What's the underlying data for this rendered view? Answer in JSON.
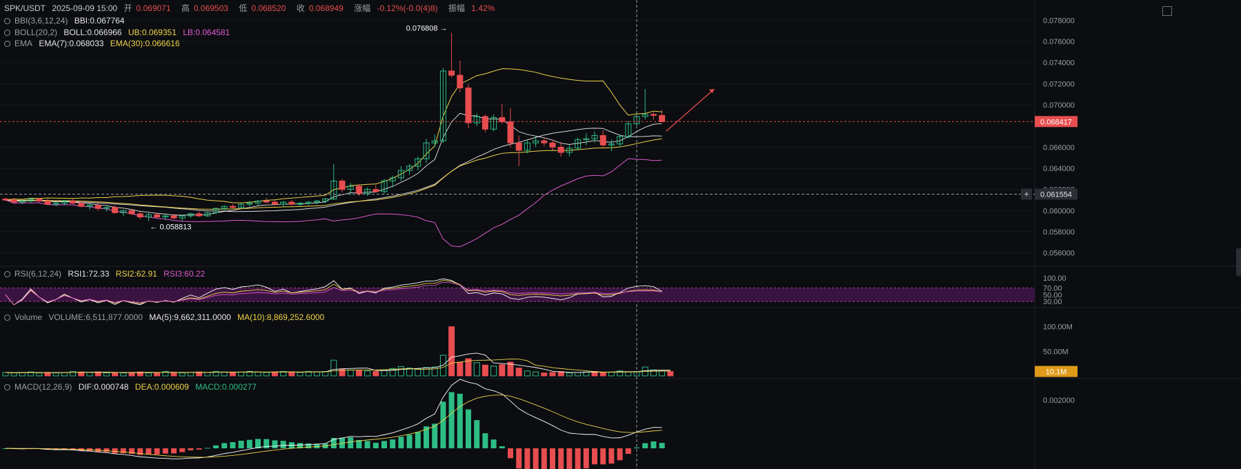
{
  "header": {
    "symbol": "SPK/USDT",
    "datetime": "2025-09-09 15:00",
    "open_label": "开",
    "open": "0.069071",
    "high_label": "高",
    "high": "0.069503",
    "low_label": "低",
    "low": "0.068520",
    "close_label": "收",
    "close": "0.068949",
    "change_label": "涨幅",
    "change": "-0.12%(-0.0(4)8)",
    "amp_label": "振幅",
    "amp": "1.42%"
  },
  "indicators": {
    "bbi": {
      "name": "BBI(3,6,12,24)",
      "value": "BBI:0.067764"
    },
    "boll": {
      "name": "BOLL(20,2)",
      "boll": "BOLL:0.066966",
      "ub": "UB:0.069351",
      "lb": "LB:0.064581"
    },
    "ema": {
      "name": "EMA",
      "ema7": "EMA(7):0.068033",
      "ema30": "EMA(30):0.066616"
    },
    "rsi": {
      "name": "RSI(6,12,24)",
      "rsi1": "RSI1:72.33",
      "rsi2": "RSI2:62.91",
      "rsi3": "RSI3:60.22"
    },
    "volume": {
      "name": "Volume",
      "vol": "VOLUME:6,511,877.0000",
      "ma5": "MA(5):9,662,311.0000",
      "ma10": "MA(10):8,869,252.6000"
    },
    "macd": {
      "name": "MACD(12,26,9)",
      "dif": "DIF:0.000748",
      "dea": "DEA:0.000609",
      "macd": "MACD:0.000277"
    }
  },
  "colors": {
    "up": "#2ebd85",
    "down": "#e84d4f",
    "boll_mid": "#d8d8d8",
    "boll_band": "#f0d44b",
    "lb": "#e05bd0",
    "ema7": "#ffffff",
    "ema30": "#f0d44b"
  },
  "chart_data": {
    "type": "candlestick",
    "price_axis": {
      "ticks": [
        "0.078000",
        "0.076000",
        "0.074000",
        "0.072000",
        "0.070000",
        "0.066000",
        "0.064000",
        "0.062000",
        "0.060000",
        "0.058000",
        "0.056000"
      ],
      "range": [
        0.055,
        0.079
      ]
    },
    "current_price_tag": "0.068417",
    "crosshair_price_tag": "0.061554",
    "max_annotation": "0.076808",
    "min_annotation": "0.058813",
    "rsi_axis": {
      "ticks": [
        "100.00",
        "70.00",
        "50.00",
        "30.00"
      ],
      "range": [
        20,
        110
      ]
    },
    "volume_axis": {
      "ticks": [
        "100.00M",
        "50.00M"
      ],
      "current_tag": "10.1M",
      "range": [
        0,
        115
      ]
    },
    "macd_axis": {
      "ticks": [
        "0.002000"
      ]
    },
    "candles": [
      [
        0.0611,
        0.0612,
        0.0609,
        0.061
      ],
      [
        0.061,
        0.0612,
        0.0607,
        0.0608
      ],
      [
        0.0608,
        0.061,
        0.0606,
        0.0609
      ],
      [
        0.0609,
        0.0612,
        0.0607,
        0.0611
      ],
      [
        0.0611,
        0.0612,
        0.0608,
        0.0609
      ],
      [
        0.0609,
        0.0611,
        0.0605,
        0.0606
      ],
      [
        0.0606,
        0.0608,
        0.0604,
        0.0607
      ],
      [
        0.0607,
        0.061,
        0.0605,
        0.0609
      ],
      [
        0.0609,
        0.0611,
        0.0606,
        0.0607
      ],
      [
        0.0607,
        0.0609,
        0.0603,
        0.0604
      ],
      [
        0.0604,
        0.0606,
        0.0601,
        0.0605
      ],
      [
        0.0605,
        0.0607,
        0.06,
        0.0602
      ],
      [
        0.0602,
        0.0604,
        0.0599,
        0.0603
      ],
      [
        0.0603,
        0.0605,
        0.0597,
        0.0598
      ],
      [
        0.0598,
        0.0601,
        0.0595,
        0.06
      ],
      [
        0.06,
        0.0601,
        0.0596,
        0.0597
      ],
      [
        0.0597,
        0.0599,
        0.0592,
        0.0594
      ],
      [
        0.0594,
        0.0598,
        0.059,
        0.0596
      ],
      [
        0.0596,
        0.0598,
        0.0593,
        0.0594
      ],
      [
        0.0594,
        0.0596,
        0.0591,
        0.0595
      ],
      [
        0.0595,
        0.0597,
        0.0592,
        0.0593
      ],
      [
        0.0593,
        0.0596,
        0.059,
        0.0595
      ],
      [
        0.0595,
        0.0598,
        0.0593,
        0.0597
      ],
      [
        0.0597,
        0.0599,
        0.0594,
        0.0595
      ],
      [
        0.0595,
        0.0599,
        0.0594,
        0.0598
      ],
      [
        0.0598,
        0.0603,
        0.0597,
        0.0602
      ],
      [
        0.0602,
        0.0605,
        0.06,
        0.0604
      ],
      [
        0.0604,
        0.0606,
        0.0602,
        0.0603
      ],
      [
        0.0603,
        0.0607,
        0.0602,
        0.0606
      ],
      [
        0.0606,
        0.0609,
        0.0604,
        0.0607
      ],
      [
        0.0607,
        0.061,
        0.0605,
        0.0609
      ],
      [
        0.0609,
        0.0612,
        0.0607,
        0.0608
      ],
      [
        0.0608,
        0.061,
        0.0605,
        0.0606
      ],
      [
        0.0606,
        0.0609,
        0.0604,
        0.0608
      ],
      [
        0.0608,
        0.061,
        0.0605,
        0.0606
      ],
      [
        0.0606,
        0.0608,
        0.0604,
        0.0607
      ],
      [
        0.0607,
        0.0609,
        0.0605,
        0.0608
      ],
      [
        0.0608,
        0.061,
        0.0606,
        0.0609
      ],
      [
        0.0609,
        0.0612,
        0.0607,
        0.0611
      ],
      [
        0.0611,
        0.0644,
        0.061,
        0.0628
      ],
      [
        0.0628,
        0.063,
        0.0617,
        0.062
      ],
      [
        0.062,
        0.0626,
        0.0615,
        0.0623
      ],
      [
        0.0623,
        0.0625,
        0.0614,
        0.0616
      ],
      [
        0.0616,
        0.0622,
        0.0614,
        0.062
      ],
      [
        0.062,
        0.0624,
        0.0617,
        0.0618
      ],
      [
        0.0618,
        0.063,
        0.0616,
        0.0628
      ],
      [
        0.0628,
        0.0633,
        0.0622,
        0.0631
      ],
      [
        0.0631,
        0.0642,
        0.0628,
        0.0638
      ],
      [
        0.0638,
        0.0644,
        0.0634,
        0.0642
      ],
      [
        0.0642,
        0.0651,
        0.0638,
        0.0649
      ],
      [
        0.0649,
        0.0668,
        0.0645,
        0.0664
      ],
      [
        0.0664,
        0.0672,
        0.066,
        0.0666
      ],
      [
        0.0666,
        0.0735,
        0.0664,
        0.0732
      ],
      [
        0.0732,
        0.0768,
        0.0726,
        0.0728
      ],
      [
        0.0728,
        0.0742,
        0.0712,
        0.0716
      ],
      [
        0.0716,
        0.072,
        0.0678,
        0.0683
      ],
      [
        0.0683,
        0.0692,
        0.068,
        0.0689
      ],
      [
        0.0689,
        0.0691,
        0.0674,
        0.0677
      ],
      [
        0.0677,
        0.0691,
        0.0675,
        0.0688
      ],
      [
        0.0688,
        0.0701,
        0.0682,
        0.0684
      ],
      [
        0.0684,
        0.0697,
        0.066,
        0.0664
      ],
      [
        0.0664,
        0.0671,
        0.0642,
        0.0657
      ],
      [
        0.0657,
        0.0667,
        0.0654,
        0.0664
      ],
      [
        0.0664,
        0.067,
        0.066,
        0.0666
      ],
      [
        0.0666,
        0.0669,
        0.0661,
        0.0664
      ],
      [
        0.0664,
        0.0667,
        0.0657,
        0.066
      ],
      [
        0.066,
        0.0665,
        0.0651,
        0.0655
      ],
      [
        0.0655,
        0.0662,
        0.0651,
        0.0659
      ],
      [
        0.0659,
        0.0669,
        0.0657,
        0.0667
      ],
      [
        0.0667,
        0.0673,
        0.0662,
        0.0668
      ],
      [
        0.0668,
        0.0675,
        0.0664,
        0.0671
      ],
      [
        0.0671,
        0.0676,
        0.066,
        0.0662
      ],
      [
        0.0662,
        0.0667,
        0.0656,
        0.0663
      ],
      [
        0.0663,
        0.0672,
        0.066,
        0.067
      ],
      [
        0.067,
        0.0685,
        0.0668,
        0.0682
      ],
      [
        0.0682,
        0.0691,
        0.0679,
        0.0689
      ],
      [
        0.0689,
        0.0715,
        0.0686,
        0.0691
      ],
      [
        0.0691,
        0.0693,
        0.0686,
        0.069
      ],
      [
        0.069,
        0.0695,
        0.0685,
        0.0684
      ]
    ],
    "volume": [
      7,
      6,
      7,
      8,
      6,
      7,
      6,
      7,
      9,
      8,
      7,
      8,
      6,
      7,
      6,
      7,
      8,
      6,
      7,
      9,
      7,
      6,
      7,
      8,
      7,
      9,
      8,
      7,
      8,
      9,
      8,
      7,
      8,
      9,
      8,
      7,
      9,
      8,
      9,
      32,
      14,
      12,
      11,
      10,
      9,
      12,
      15,
      19,
      16,
      14,
      17,
      18,
      42,
      100,
      28,
      35,
      27,
      22,
      20,
      23,
      28,
      16,
      10,
      8,
      6,
      7,
      9,
      6,
      7,
      8,
      9,
      7,
      8,
      10,
      8,
      9,
      18,
      12,
      10,
      9
    ],
    "volume_colors_down_index": [
      5,
      9,
      11,
      13,
      15,
      16,
      18,
      20,
      23,
      27,
      32,
      34,
      40,
      42,
      44,
      53,
      54,
      55,
      57,
      59,
      60,
      61,
      64,
      65,
      66,
      70,
      71,
      79
    ]
  }
}
